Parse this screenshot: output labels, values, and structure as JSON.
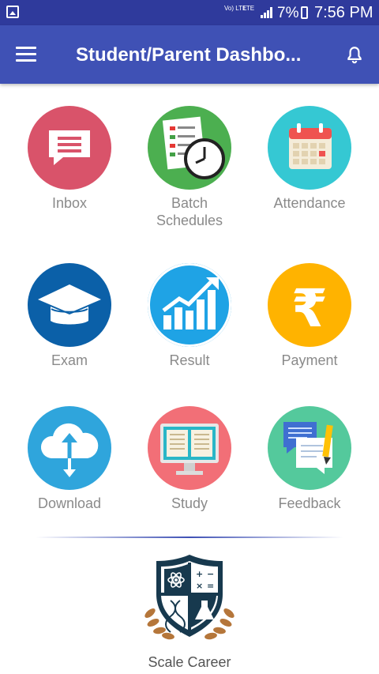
{
  "status_bar": {
    "volte": "Vo) LTE",
    "lte": "LTE",
    "battery_percent": "7%",
    "time": "7:56 PM"
  },
  "app_bar": {
    "title": "Student/Parent Dashbo..."
  },
  "tiles": [
    {
      "label": "Inbox",
      "color": "#d9536a",
      "icon": "inbox-message-icon"
    },
    {
      "label": "Batch Schedules",
      "color": "#4caf50",
      "icon": "schedule-checklist-clock-icon"
    },
    {
      "label": "Attendance",
      "color": "#35c8d3",
      "icon": "calendar-icon"
    },
    {
      "label": "Exam",
      "color": "#0b60a8",
      "icon": "graduation-cap-icon"
    },
    {
      "label": "Result",
      "color": "#1fa3e5",
      "icon": "growth-chart-icon"
    },
    {
      "label": "Payment",
      "color": "#ffb300",
      "icon": "rupee-icon"
    },
    {
      "label": "Download",
      "color": "#2fa5dc",
      "icon": "cloud-download-icon"
    },
    {
      "label": "Study",
      "color": "#f26f77",
      "icon": "open-book-monitor-icon"
    },
    {
      "label": "Feedback",
      "color": "#54c99c",
      "icon": "feedback-chat-pencil-icon"
    }
  ],
  "brand": {
    "name": "Scale Career"
  }
}
